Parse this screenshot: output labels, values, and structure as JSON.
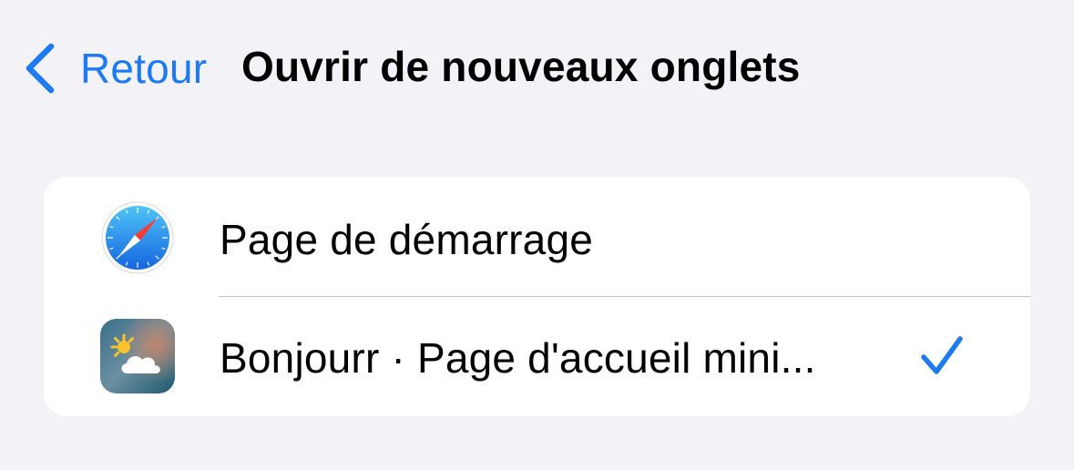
{
  "nav": {
    "back_label": "Retour",
    "back_icon": "chevron-left-icon",
    "title": "Ouvrir de nouveaux onglets"
  },
  "options": [
    {
      "label": "Page de démarrage",
      "icon": "safari-compass-icon",
      "selected": false
    },
    {
      "label": "Bonjourr · Page d'accueil mini...",
      "icon": "bonjourr-weather-icon",
      "selected": true
    }
  ],
  "colors": {
    "accent": "#1d7af3",
    "background": "#f2f2f7",
    "card": "#ffffff",
    "separator": "#c6c6c8"
  }
}
